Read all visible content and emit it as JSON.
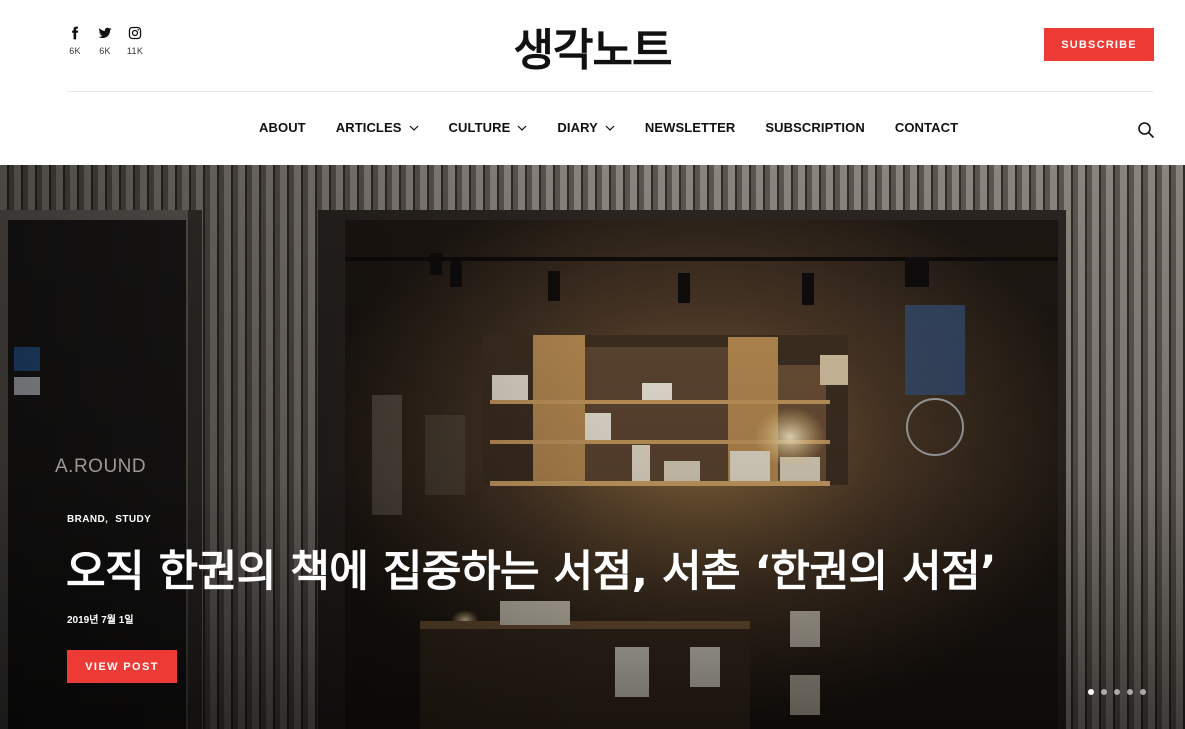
{
  "header": {
    "logo": "생각노트",
    "subscribe_label": "SUBSCRIBE",
    "social": [
      {
        "icon": "facebook-icon",
        "count": "6K"
      },
      {
        "icon": "twitter-icon",
        "count": "6K"
      },
      {
        "icon": "instagram-icon",
        "count": "11K"
      }
    ]
  },
  "nav": {
    "items": [
      {
        "label": "ABOUT",
        "dropdown": false
      },
      {
        "label": "ARTICLES",
        "dropdown": true
      },
      {
        "label": "CULTURE",
        "dropdown": true
      },
      {
        "label": "DIARY",
        "dropdown": true
      },
      {
        "label": "NEWSLETTER",
        "dropdown": false
      },
      {
        "label": "SUBSCRIPTION",
        "dropdown": false
      },
      {
        "label": "CONTACT",
        "dropdown": false
      }
    ],
    "search_icon": "search-icon"
  },
  "hero": {
    "categories": [
      "BRAND,",
      "STUDY"
    ],
    "title": "오직 한권의 책에 집중하는 서점, 서촌 ‘한권의 서점’",
    "date": "2019년 7월 1일",
    "button_label": "VIEW POST",
    "sign_text": "A.ROUND",
    "slides": 5,
    "active_slide": 1
  },
  "colors": {
    "accent": "#ee3a34"
  }
}
